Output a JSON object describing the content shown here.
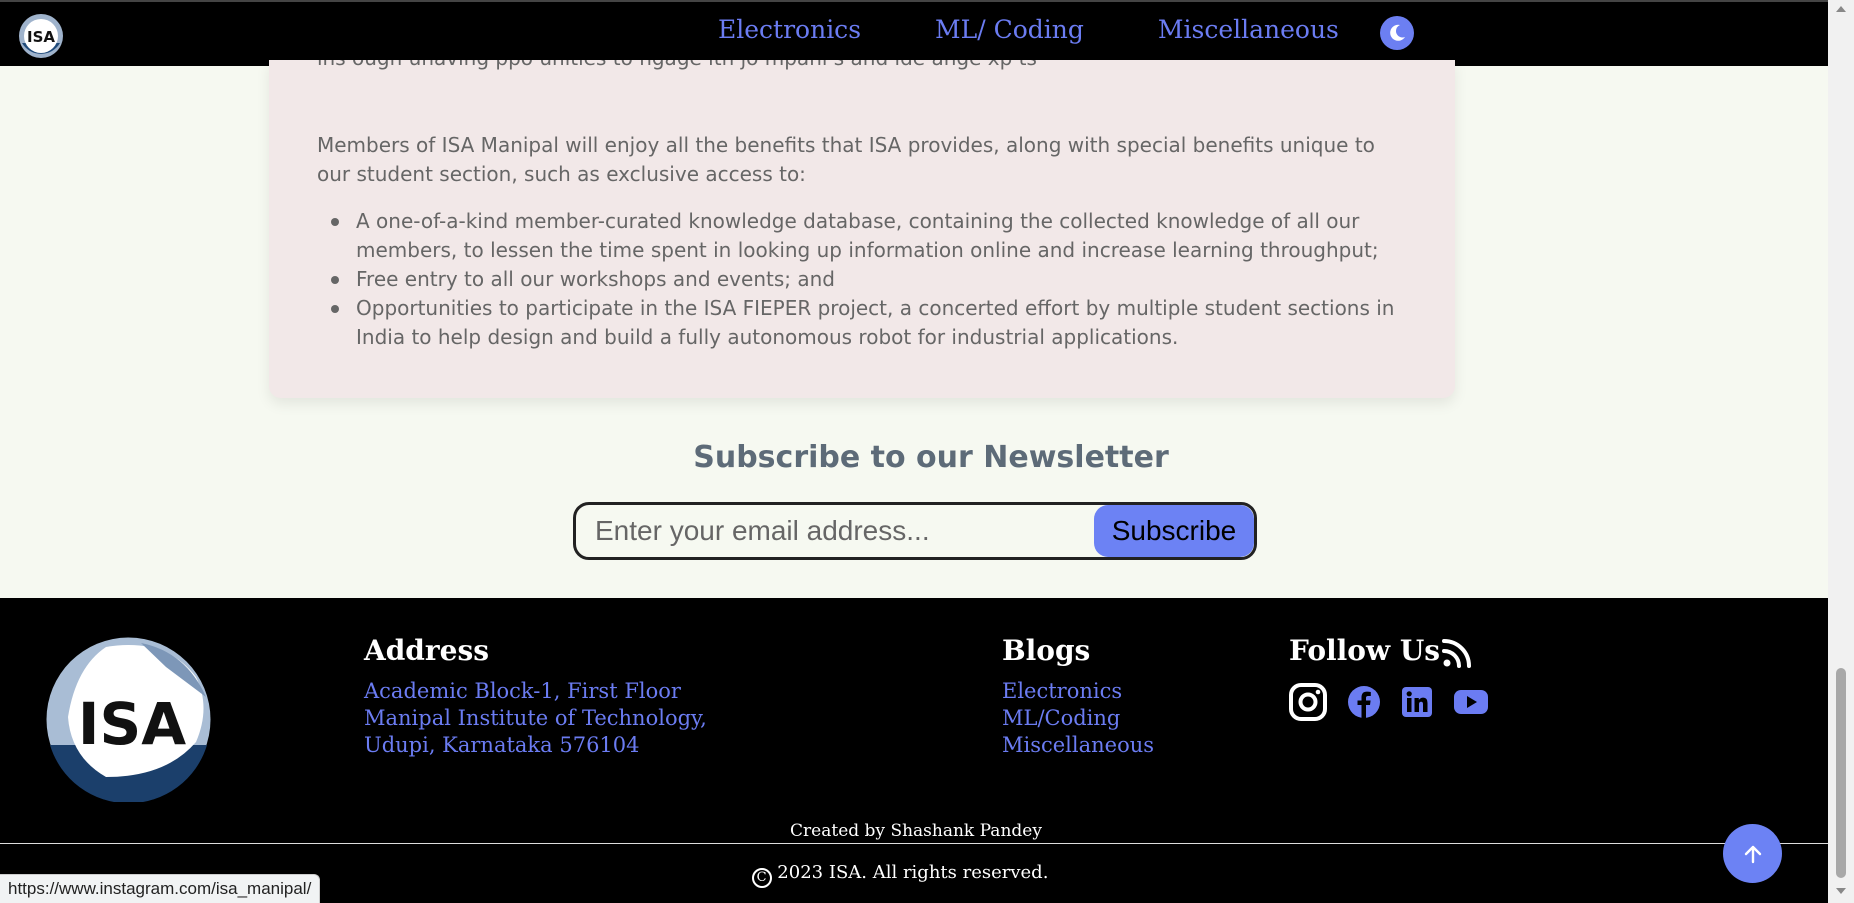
{
  "nav": {
    "logo_text": "ISA",
    "links": [
      "Electronics",
      "ML/ Coding",
      "Miscellaneous"
    ],
    "theme_icon": "moon-icon"
  },
  "card": {
    "cut_line": "ins  ough   unaving   ppo  unities to  ngage  ith    jo  mpani  s and   ide   ange  xp  ts",
    "intro": "Members of ISA Manipal will enjoy all the benefits that ISA provides, along with special benefits unique to our student section, such as exclusive access to:",
    "items": [
      "A one-of-a-kind member-curated knowledge database, containing the collected knowledge of all our members, to lessen the time spent in looking up information online and increase learning throughput;",
      "Free entry to all our workshops and events; and",
      "Opportunities to participate in the ISA FIEPER project, a concerted effort by multiple student sections in India to help design and build a fully autonomous robot for industrial applications."
    ]
  },
  "newsletter": {
    "title": "Subscribe to our Newsletter",
    "placeholder": "Enter your email address...",
    "button": "Subscribe"
  },
  "footer": {
    "logo_text": "ISA",
    "address_title": "Address",
    "address_lines": [
      "Academic Block-1, First Floor",
      "Manipal Institute of Technology,",
      "Udupi, Karnataka 576104"
    ],
    "blogs_title": "Blogs",
    "blogs_links": [
      "Electronics",
      "ML/Coding",
      "Miscellaneous"
    ],
    "follow_title": "Follow Us",
    "social_icons": [
      "instagram-icon",
      "facebook-icon",
      "linkedin-icon",
      "youtube-icon"
    ],
    "credit": "Created by Shashank Pandey",
    "copyright_symbol": "C",
    "copyright": "2023 ISA. All rights reserved."
  },
  "status_url": "https://www.instagram.com/isa_manipal/",
  "colors": {
    "accent": "#6b7cf2",
    "button": "#6c82f4",
    "page_bg": "#f6f9f1",
    "card_bg": "#f2e8e8"
  }
}
